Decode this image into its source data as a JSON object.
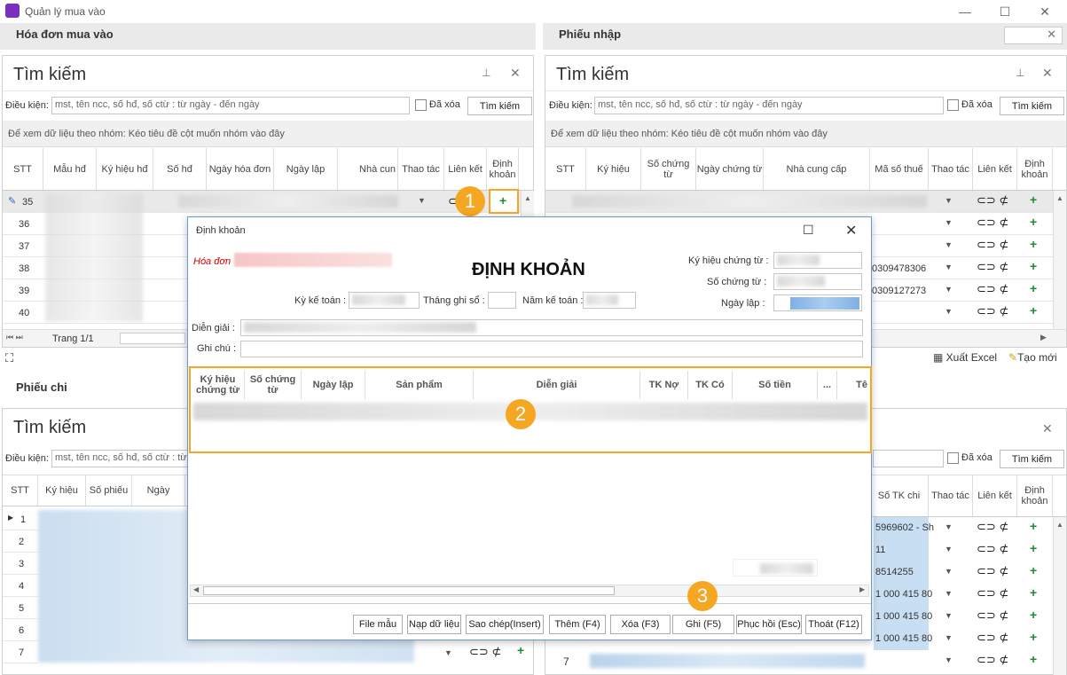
{
  "app": {
    "title": "Quản lý mua vào"
  },
  "left_top": {
    "section_title": "Hóa đơn mua vào",
    "search_title": "Tìm kiếm",
    "cond_label": "Điều kiện:",
    "cond_placeholder": "mst, tên ncc, số hđ, số ctừ : từ ngày - đến ngày",
    "deleted_label": "Đã xóa",
    "search_button": "Tìm kiếm",
    "group_hint": "Để xem dữ liệu theo nhóm: Kéo tiêu đề cột muốn nhóm vào đây",
    "columns": [
      "STT",
      "Mẫu hđ",
      "Ký hiệu hđ",
      "Số hđ",
      "Ngày hóa đơn",
      "Ngày lập",
      "Nhà cun",
      "Thao tác",
      "Liên kết",
      "Định khoản"
    ],
    "rows": [
      "35",
      "36",
      "37",
      "38",
      "39",
      "40"
    ],
    "row_s": "5",
    "pager": "Trang 1/1"
  },
  "right_top": {
    "section_title": "Phiếu nhập",
    "search_title": "Tìm kiếm",
    "cond_label": "Điều kiện:",
    "cond_placeholder": "mst, tên ncc, số hđ, số ctừ : từ ngày - đến ngày",
    "deleted_label": "Đã xóa",
    "search_button": "Tìm kiếm",
    "group_hint": "Để xem dữ liệu theo nhóm: Kéo tiêu đề cột muốn nhóm vào đây",
    "columns": [
      "STT",
      "Ký hiệu",
      "Số chứng từ",
      "Ngày chứng từ",
      "Nhà cung cấp",
      "Mã số thuế",
      "Thao tác",
      "Liên kết",
      "Định khoản"
    ],
    "tax_values": [
      "0309478306",
      "0309127273"
    ]
  },
  "toolbar": {
    "export_excel": "Xuất Excel",
    "new": "Tạo mới"
  },
  "left_bottom": {
    "section_title": "Phiếu chi",
    "search_title": "Tìm kiếm",
    "cond_label": "Điều kiện:",
    "cond_placeholder": "mst, tên ncc, số hđ, số ctừ : từ ngày - đến ngày",
    "columns": [
      "STT",
      "Ký hiệu",
      "Số phiếu",
      "Ngày"
    ],
    "rows": [
      "1",
      "2",
      "3",
      "4",
      "5",
      "6",
      "7"
    ]
  },
  "right_bottom": {
    "deleted_label": "Đã xóa",
    "search_button": "Tìm kiếm",
    "columns": [
      "Số TK chi",
      "Thao tác",
      "Liên kết",
      "Định khoản"
    ],
    "account_values": [
      "5969602 - Sh",
      "11",
      "8514255",
      "1 000 415 80",
      "1 000 415 80",
      "1 000 415 80"
    ],
    "stt_last": "7"
  },
  "dialog": {
    "window_title": "Định khoản",
    "heading": "ĐỊNH KHOẢN",
    "invoice_label": "Hóa đơn",
    "ky_ke_toan": "Kỳ kế toán :",
    "thang_ghi_so": "Tháng ghi sổ :",
    "nam_ke_toan": "Năm kế toán :",
    "ky_hieu_chung_tu": "Ký hiệu chứng từ :",
    "so_chung_tu": "Số chứng từ :",
    "ngay_lap": "Ngày lập :",
    "dien_giai": "Diễn giải :",
    "ghi_chu": "Ghi chú :",
    "columns": [
      "Ký hiệu chứng từ",
      "Số chứng từ",
      "Ngày lập",
      "Sản phẩm",
      "Diễn giải",
      "TK Nợ",
      "TK Có",
      "Số tiền",
      "...",
      "Tê"
    ],
    "buttons": {
      "file_mau": "File mẫu",
      "nap_du_lieu": "Nạp dữ liệu",
      "sao_chep": "Sao chép(Insert)",
      "them": "Thêm (F4)",
      "xoa": "Xóa (F3)",
      "ghi": "Ghi (F5)",
      "phuc_hoi": "Phục hồi (Esc)",
      "thoat": "Thoát (F12)"
    }
  },
  "callouts": {
    "one": "1",
    "two": "2",
    "three": "3"
  },
  "colors": {
    "accent": "#f5a623",
    "plus": "#1a8f2c",
    "selected_row": "#e9e9e9"
  }
}
